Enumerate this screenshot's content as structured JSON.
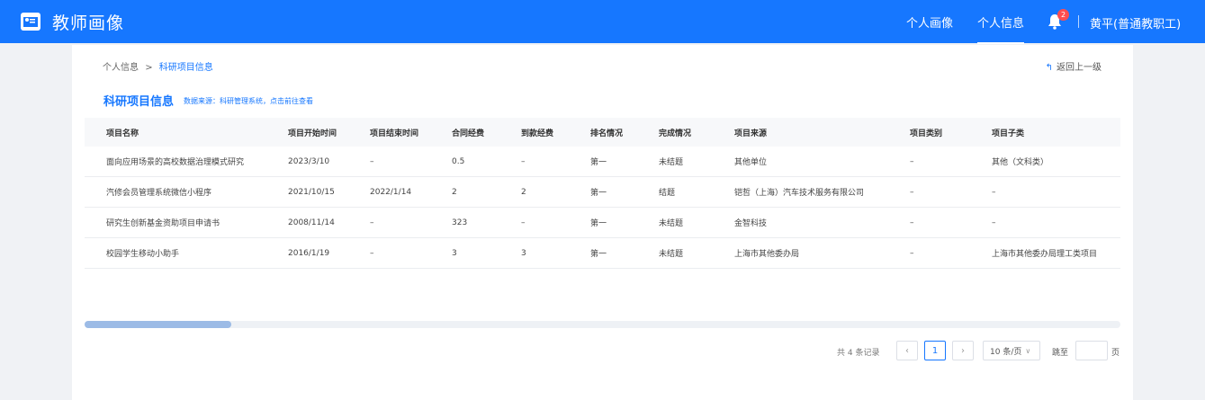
{
  "header": {
    "app_title": "教师画像",
    "nav": [
      {
        "label": "个人画像",
        "active": false
      },
      {
        "label": "个人信息",
        "active": true
      }
    ],
    "notification_count": "2",
    "user_name": "黄平(普通教职工)",
    "accent_color": "#1677ff"
  },
  "breadcrumb": {
    "parent": "个人信息",
    "separator": ">",
    "current": "科研项目信息"
  },
  "back_label": "返回上一级",
  "section": {
    "title": "科研项目信息",
    "note": "数据来源：科研管理系统，点击前往查看"
  },
  "table": {
    "columns": [
      "项目名称",
      "项目开始时间",
      "项目结束时间",
      "合同经费",
      "到款经费",
      "排名情况",
      "完成情况",
      "项目来源",
      "项目类别",
      "项目子类"
    ],
    "rows": [
      [
        "面向应用场景的高校数据治理模式研究",
        "2023/3/10",
        "–",
        "0.5",
        "–",
        "第一",
        "未结题",
        "其他单位",
        "–",
        "其他（文科类）"
      ],
      [
        "汽修会员管理系统微信小程序",
        "2021/10/15",
        "2022/1/14",
        "2",
        "2",
        "第一",
        "结题",
        "铠哲（上海）汽车技术服务有限公司",
        "–",
        "–"
      ],
      [
        "研究生创新基金资助项目申请书",
        "2008/11/14",
        "–",
        "323",
        "–",
        "第一",
        "未结题",
        "金智科技",
        "–",
        "–"
      ],
      [
        "校园学生移动小助手",
        "2016/1/19",
        "–",
        "3",
        "3",
        "第一",
        "未结题",
        "上海市其他委办局",
        "–",
        "上海市其他委办局理工类项目"
      ]
    ]
  },
  "pagination": {
    "total_text": "共 4 条记录",
    "prev_icon": "‹",
    "current_page": "1",
    "next_icon": "›",
    "page_size": "10 条/页",
    "jump_label": "跳至",
    "jump_suffix": "页"
  }
}
